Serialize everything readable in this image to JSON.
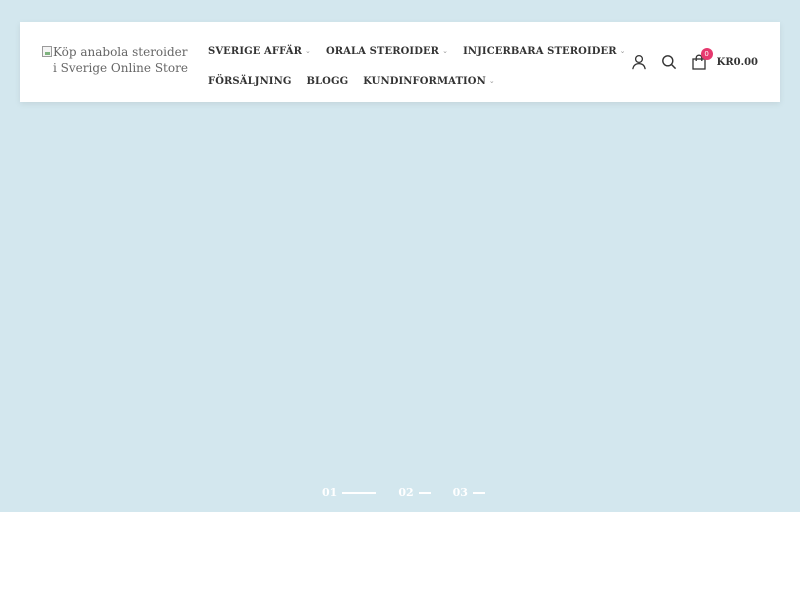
{
  "header": {
    "logo_alt": "Köp anabola steroider i Sverige Online Store"
  },
  "nav": {
    "items": [
      {
        "label": "SVERIGE AFFÄR",
        "has_dropdown": true
      },
      {
        "label": "ORALA STEROIDER",
        "has_dropdown": true
      },
      {
        "label": "INJICERBARA STEROIDER",
        "has_dropdown": true
      },
      {
        "label": "FÖRSÄLJNING",
        "has_dropdown": false
      },
      {
        "label": "BLOGG",
        "has_dropdown": false
      },
      {
        "label": "KUNDINFORMATION",
        "has_dropdown": true
      }
    ]
  },
  "tools": {
    "cart_count": "0",
    "cart_total": "KR0.00",
    "icons": [
      "user-icon",
      "search-icon",
      "shopping-bag-icon"
    ]
  },
  "slider": {
    "pages": [
      "01",
      "02",
      "03"
    ],
    "active_index": 0
  },
  "colors": {
    "hero_background": "#d3e7ee",
    "badge": "#e6386e",
    "text": "#333333"
  }
}
